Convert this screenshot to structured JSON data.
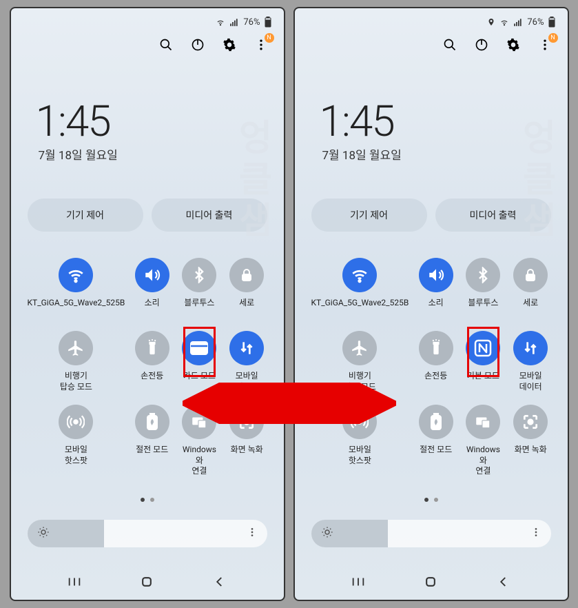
{
  "status": {
    "battery": "76%",
    "has_location_left": false,
    "has_location_right": true
  },
  "notification_badge": "N",
  "clock": {
    "time": "1:45",
    "date": "7월 18일 월요일"
  },
  "pills": {
    "device_control": "기기 제어",
    "media_output": "미디어 출력"
  },
  "tiles": [
    {
      "id": "wifi",
      "label": "KT_GiGA_5G_Wave2_525B",
      "active": true,
      "icon": "wifi"
    },
    {
      "id": "sound",
      "label": "소리",
      "active": true,
      "icon": "volume"
    },
    {
      "id": "bluetooth",
      "label": "블루투스",
      "active": false,
      "icon": "bluetooth"
    },
    {
      "id": "rotation",
      "label": "세로",
      "active": false,
      "icon": "lock"
    },
    {
      "id": "airplane",
      "label": "비행기\n탑승 모드",
      "active": false,
      "icon": "airplane"
    },
    {
      "id": "flashlight",
      "label": "손전등",
      "active": false,
      "icon": "flashlight"
    },
    {
      "id": "nfc-left",
      "label": "카드 모드",
      "active": true,
      "icon": "nfc-card",
      "highlighted": true
    },
    {
      "id": "mobile-data",
      "label": "모바일\n데이터",
      "active": true,
      "icon": "data"
    },
    {
      "id": "hotspot",
      "label": "모바일\n핫스팟",
      "active": false,
      "icon": "hotspot"
    },
    {
      "id": "power-save",
      "label": "절전 모드",
      "active": false,
      "icon": "battery-save"
    },
    {
      "id": "windows",
      "label": "Windows와\n연결",
      "active": false,
      "icon": "windows"
    },
    {
      "id": "screen-record",
      "label": "화면 녹화",
      "active": false,
      "icon": "record"
    }
  ],
  "tiles_right_diff": {
    "index": 6,
    "id": "nfc-right",
    "label": "기본 모드",
    "active": true,
    "icon": "nfc-n",
    "highlighted": true
  },
  "brightness": {
    "percent": 32
  },
  "colors": {
    "active_tile": "#2e6fe8",
    "inactive_tile": "#b0b8c0",
    "highlight": "#e60000",
    "badge": "#ff9933"
  }
}
